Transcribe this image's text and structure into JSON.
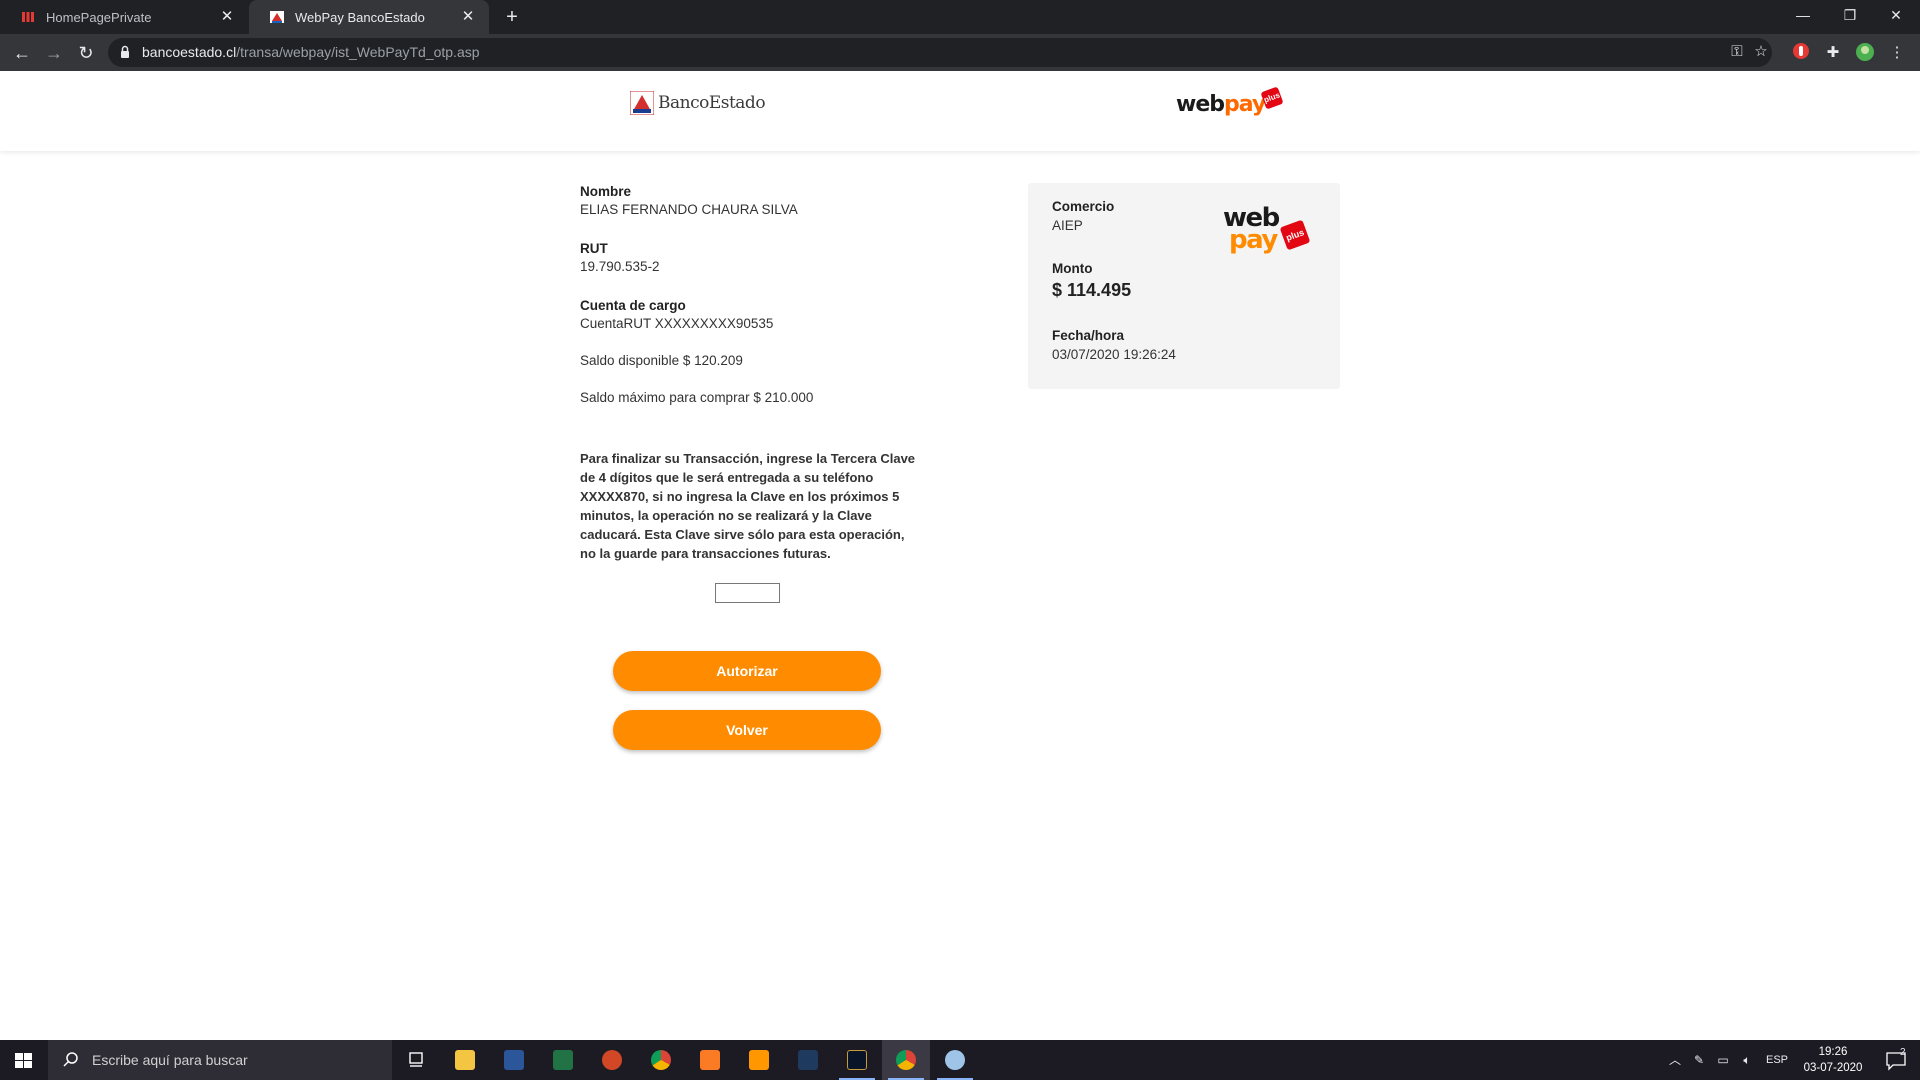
{
  "browser": {
    "tabs": [
      {
        "title": "HomePagePrivate",
        "active": false
      },
      {
        "title": "WebPay BancoEstado",
        "active": true
      }
    ],
    "url_host": "bancoestado.cl",
    "url_path": "/transa/webpay/ist_WebPayTd_otp.asp"
  },
  "header": {
    "bank_logo_text": "BancoEstado",
    "webpay_text_1": "web",
    "webpay_text_2": "pay",
    "plus_text": "plus"
  },
  "customer": {
    "nombre_label": "Nombre",
    "nombre_value": "ELIAS FERNANDO CHAURA SILVA",
    "rut_label": "RUT",
    "rut_value": "19.790.535-2",
    "cuenta_label": "Cuenta de cargo",
    "cuenta_value": "CuentaRUT XXXXXXXXX90535",
    "saldo_disponible": "Saldo disponible $ 120.209",
    "saldo_maximo": "Saldo máximo para comprar $ 210.000"
  },
  "instructions": "Para finalizar su Transacción, ingrese la Tercera Clave de 4 dígitos que le será entregada a su teléfono XXXXX870, si no ingresa la Clave    en los próximos 5 minutos, la operación no se realizará y la Clave caducará. Esta Clave sirve sólo para esta operación, no la guarde para transacciones futuras.",
  "otp": {
    "value": ""
  },
  "buttons": {
    "autorizar": "Autorizar",
    "volver": "Volver"
  },
  "summary": {
    "comercio_label": "Comercio",
    "comercio_value": "AIEP",
    "monto_label": "Monto",
    "monto_value": "$ 114.495",
    "fecha_label": "Fecha/hora",
    "fecha_value": "03/07/2020 19:26:24"
  },
  "taskbar": {
    "search_placeholder": "Escribe aquí para buscar",
    "language": "ESP",
    "time": "19:26",
    "date": "03-07-2020",
    "notifications": "2"
  },
  "colors": {
    "accent_orange": "#ff8c00",
    "webpay_red": "#e30613",
    "summary_bg": "#f4f4f4"
  }
}
